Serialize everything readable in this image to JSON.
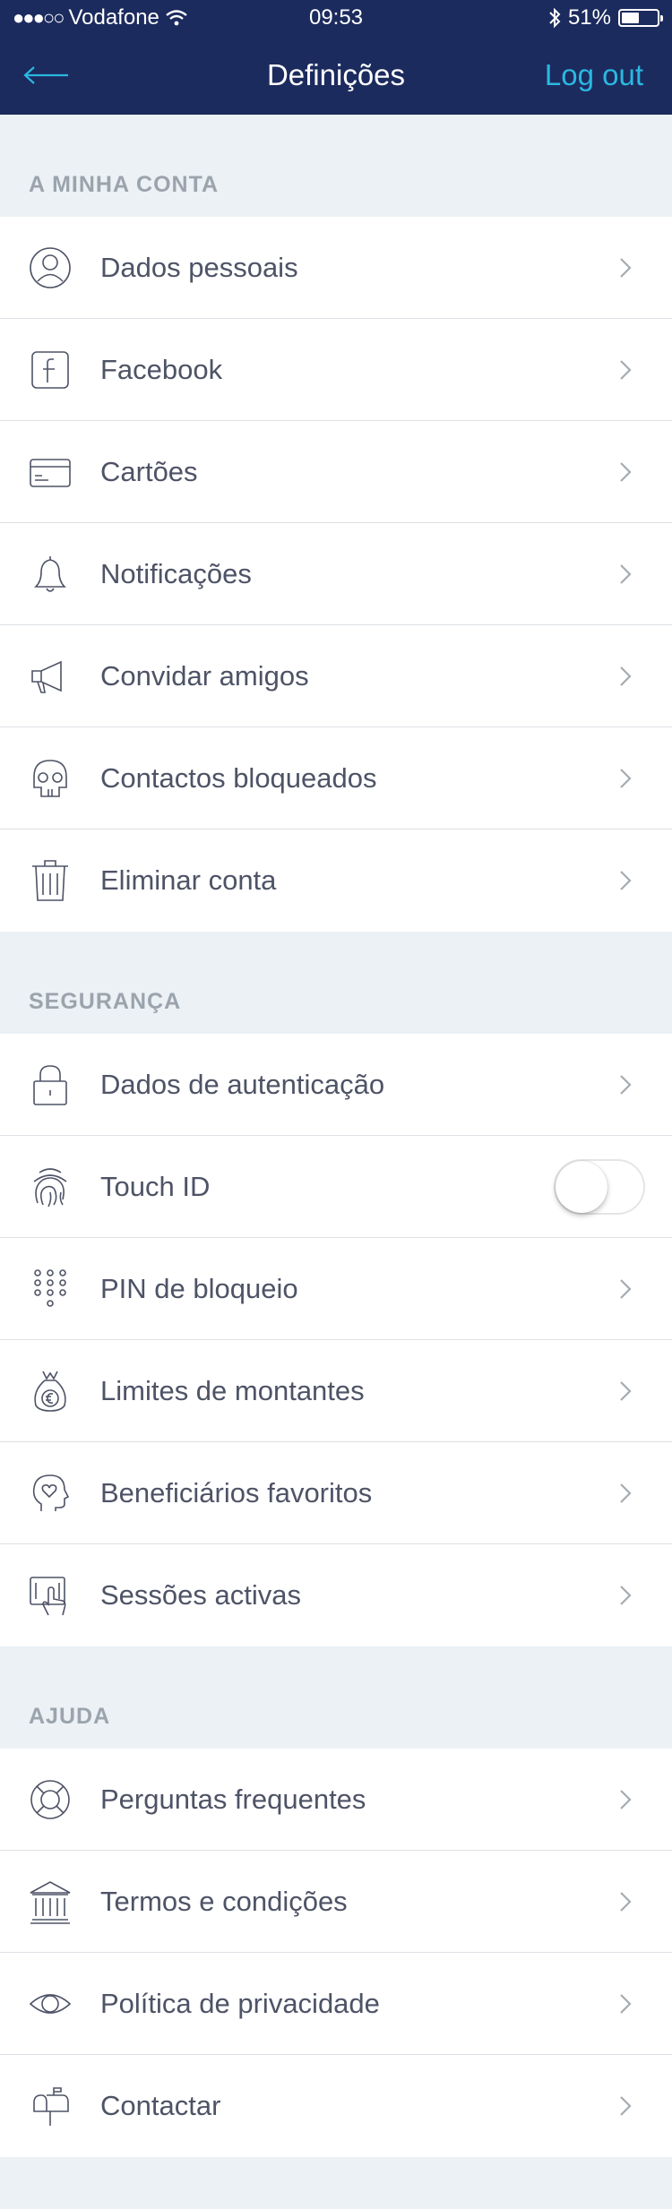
{
  "status_bar": {
    "signal": "●●●○○",
    "carrier": "Vodafone",
    "time": "09:53",
    "battery": "51%",
    "battery_level": 0.51
  },
  "nav": {
    "back_icon": "arrow-left-icon",
    "title": "Definições",
    "logout": "Log out"
  },
  "colors": {
    "header_bg": "#1c2b5e",
    "accent": "#2bb8e0",
    "page_bg": "#ebf1f5"
  },
  "sections": [
    {
      "title": "A MINHA CONTA",
      "items": [
        {
          "label": "Dados pessoais",
          "icon": "user-icon"
        },
        {
          "label": "Facebook",
          "icon": "facebook-icon"
        },
        {
          "label": "Cartões",
          "icon": "card-icon"
        },
        {
          "label": "Notificações",
          "icon": "bell-icon"
        },
        {
          "label": "Convidar amigos",
          "icon": "megaphone-icon"
        },
        {
          "label": "Contactos bloqueados",
          "icon": "skull-icon"
        },
        {
          "label": "Eliminar conta",
          "icon": "trash-icon"
        }
      ]
    },
    {
      "title": "SEGURANÇA",
      "items": [
        {
          "label": "Dados de autenticação",
          "icon": "lock-icon"
        },
        {
          "label": "Touch ID",
          "icon": "fingerprint-icon",
          "toggle": false
        },
        {
          "label": "PIN de bloqueio",
          "icon": "keypad-icon"
        },
        {
          "label": "Limites de montantes",
          "icon": "money-bag-icon"
        },
        {
          "label": "Beneficiários favoritos",
          "icon": "head-heart-icon"
        },
        {
          "label": "Sessões activas",
          "icon": "tablet-touch-icon"
        }
      ]
    },
    {
      "title": "AJUDA",
      "items": [
        {
          "label": "Perguntas frequentes",
          "icon": "lifebuoy-icon"
        },
        {
          "label": "Termos e condições",
          "icon": "bank-icon"
        },
        {
          "label": "Política de privacidade",
          "icon": "eye-icon"
        },
        {
          "label": "Contactar",
          "icon": "mailbox-icon"
        }
      ]
    }
  ]
}
